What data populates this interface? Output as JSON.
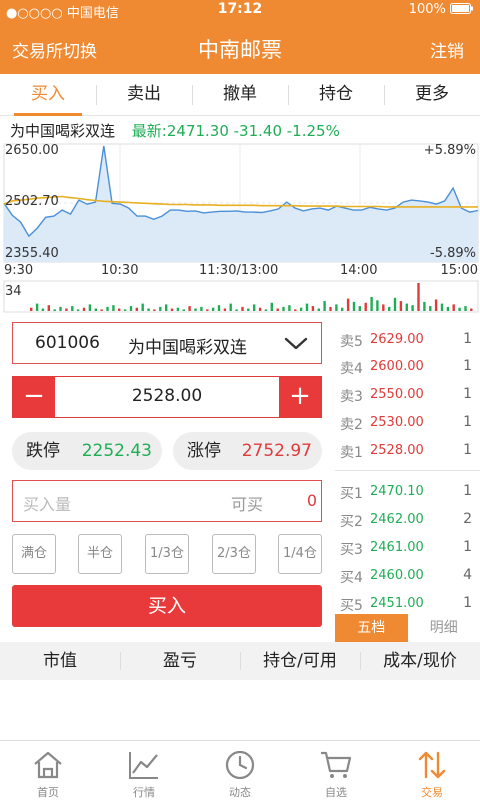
{
  "status_bar": {
    "carrier": "●○○○○ 中国电信",
    "time": "17:12",
    "battery": "100%"
  },
  "nav": {
    "left": "交易所切换",
    "title": "中南邮票",
    "right": "注销"
  },
  "tabs": [
    {
      "label": "买入",
      "active": true
    },
    {
      "label": "卖出"
    },
    {
      "label": "撤单"
    },
    {
      "label": "持仓"
    },
    {
      "label": "更多"
    }
  ],
  "stock": {
    "name": "为中国喝彩双连",
    "latest": "最新:2471.30 -31.40 -1.25%"
  },
  "chart_data": {
    "type": "line",
    "y_max_label": "2650.00",
    "y_mid_label": "2502.70",
    "y_min_label": "2355.40",
    "pct_max_label": "+5.89%",
    "pct_min_label": "-5.89%",
    "ylim": [
      2355.4,
      2650.0
    ],
    "x_labels": [
      "9:30",
      "10:30",
      "11:30/13:00",
      "14:00",
      "15:00"
    ],
    "volume_label": "34",
    "price": [
      2502,
      2472,
      2455,
      2420,
      2440,
      2467,
      2470,
      2485,
      2475,
      2510,
      2500,
      2505,
      2645,
      2502,
      2500,
      2490,
      2470,
      2470,
      2462,
      2470,
      2485,
      2485,
      2482,
      2483,
      2478,
      2480,
      2482,
      2482,
      2483,
      2480,
      2480,
      2479,
      2483,
      2488,
      2505,
      2490,
      2483,
      2488,
      2490,
      2485,
      2495,
      2490,
      2485,
      2485,
      2492,
      2488,
      2485,
      2490,
      2505,
      2510,
      2508,
      2505,
      2500,
      2508,
      2540,
      2490,
      2480,
      2484
    ],
    "avg": [
      2500,
      2508,
      2510,
      2512,
      2515,
      2516,
      2518,
      2519,
      2516,
      2514,
      2511,
      2509,
      2507,
      2506,
      2505,
      2504,
      2503,
      2502,
      2501,
      2500,
      2499,
      2499,
      2499,
      2498,
      2498,
      2498,
      2497,
      2497,
      2497,
      2497,
      2497,
      2496,
      2496,
      2496,
      2496,
      2496,
      2495,
      2495,
      2495,
      2495,
      2495,
      2494,
      2494,
      2494,
      2494,
      2494,
      2493,
      2493,
      2493,
      2493,
      2493,
      2493,
      2493,
      2493,
      2493,
      2493,
      2493,
      2493
    ],
    "volume": [
      4,
      9,
      3,
      7,
      2,
      5,
      3,
      6,
      2,
      4,
      8,
      3,
      2,
      5,
      7,
      3,
      2,
      6,
      4,
      9,
      3,
      2,
      5,
      8,
      3,
      4,
      2,
      6,
      3,
      5,
      2,
      4,
      7,
      3,
      9,
      2,
      5,
      3,
      8,
      4,
      2,
      10,
      3,
      5,
      7,
      2,
      4,
      9,
      6,
      3,
      12,
      5,
      8,
      4,
      15,
      11,
      6,
      10,
      17,
      13,
      8,
      5,
      16,
      12,
      9,
      7,
      34,
      11,
      6,
      14,
      9,
      5,
      8,
      4,
      6,
      3
    ],
    "volume_colors": [
      "#e03a3a",
      "#1fae55"
    ],
    "line_color": "#4a90d9",
    "fill_color": "#dce9f7",
    "avg_color": "#e8b020"
  },
  "form": {
    "stock_code": "601006",
    "stock_name": "为中国喝彩双连",
    "price": "2528.00",
    "minus": "−",
    "plus": "+",
    "limit_down_label": "跌停",
    "limit_down_value": "2252.43",
    "limit_up_label": "涨停",
    "limit_up_value": "2752.97",
    "qty_placeholder": "买入量",
    "available_label": "可买",
    "available_value": "0",
    "position_buttons": [
      "满仓",
      "半仓",
      "1/3仓",
      "2/3仓",
      "1/4仓"
    ],
    "buy_button": "买入"
  },
  "orderbook": {
    "asks": [
      {
        "label": "卖5",
        "price": "2629.00",
        "vol": "1"
      },
      {
        "label": "卖4",
        "price": "2600.00",
        "vol": "1"
      },
      {
        "label": "卖3",
        "price": "2550.00",
        "vol": "1"
      },
      {
        "label": "卖2",
        "price": "2530.00",
        "vol": "1"
      },
      {
        "label": "卖1",
        "price": "2528.00",
        "vol": "1"
      }
    ],
    "bids": [
      {
        "label": "买1",
        "price": "2470.10",
        "vol": "1"
      },
      {
        "label": "买2",
        "price": "2462.00",
        "vol": "2"
      },
      {
        "label": "买3",
        "price": "2461.00",
        "vol": "1"
      },
      {
        "label": "买4",
        "price": "2460.00",
        "vol": "4"
      },
      {
        "label": "买5",
        "price": "2451.00",
        "vol": "1"
      }
    ],
    "ask_color": "#e03a3a",
    "bid_color": "#1fae55",
    "tabs": [
      {
        "label": "五档",
        "active": true
      },
      {
        "label": "明细"
      }
    ]
  },
  "positions_header": [
    "市值",
    "盈亏",
    "持仓/可用",
    "成本/现价"
  ],
  "tab_bar": [
    {
      "label": "首页",
      "icon": "home-icon"
    },
    {
      "label": "行情",
      "icon": "line-chart-icon"
    },
    {
      "label": "动态",
      "icon": "clock-icon"
    },
    {
      "label": "自选",
      "icon": "cart-icon"
    },
    {
      "label": "交易",
      "icon": "trade-arrows-icon",
      "active": true
    }
  ],
  "colors": {
    "brand": "#f08a32",
    "red": "#e83a3a",
    "green": "#1fae55"
  }
}
